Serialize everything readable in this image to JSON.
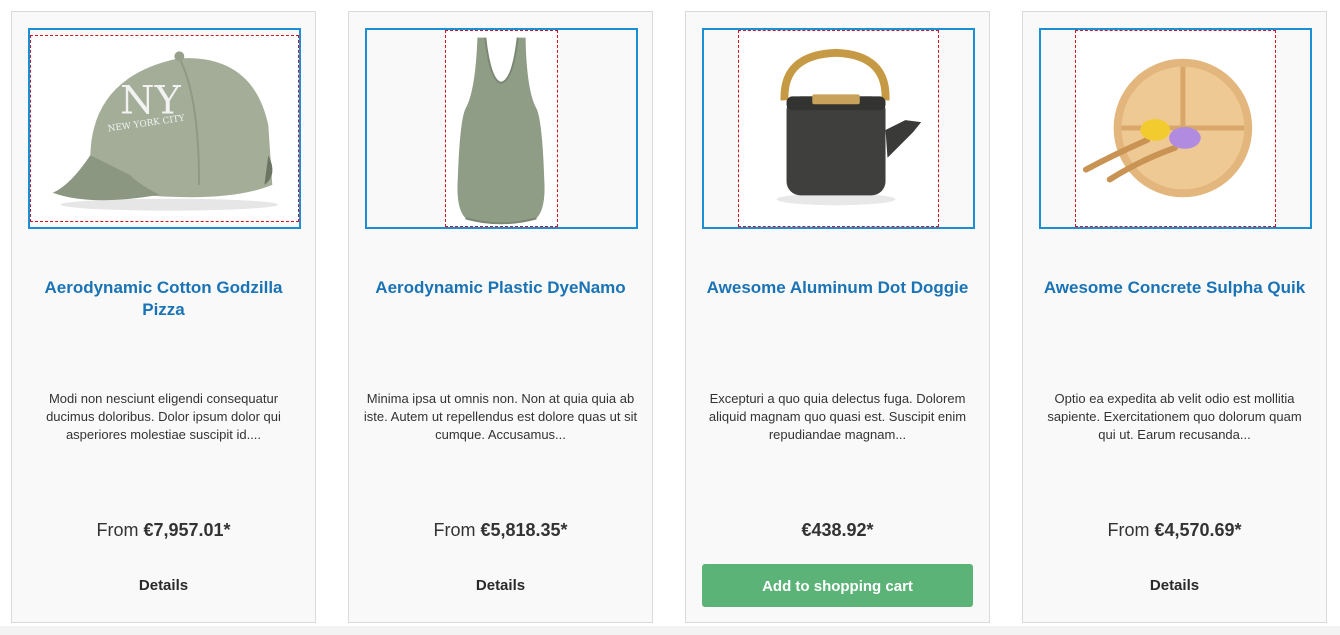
{
  "products": [
    {
      "title": "Aerodynamic Cotton Godzilla Pizza",
      "description": "Modi non nesciunt eligendi consequatur ducimus doloribus. Dolor ipsum dolor qui asperiores molestiae suscipit id....",
      "price_prefix": "From ",
      "price": "€7,957.01*",
      "action": "Details",
      "image": "cap-image",
      "cap_text": "NY",
      "cap_subtext": "NEW YORK CITY"
    },
    {
      "title": "Aerodynamic Plastic DyeNamo",
      "description": "Minima ipsa ut omnis non. Non at quia quia ab iste. Autem ut repellendus est dolore quas ut sit cumque. Accusamus...",
      "price_prefix": "From ",
      "price": "€5,818.35*",
      "action": "Details",
      "image": "tank-top-image"
    },
    {
      "title": "Awesome Aluminum Dot Doggie",
      "description": "Excepturi a quo quia delectus fuga. Dolorem aliquid magnam quo quasi est. Suscipit enim repudiandae magnam...",
      "price_prefix": "",
      "price": "€438.92*",
      "action": "Add to shopping cart",
      "image": "teapot-image"
    },
    {
      "title": "Awesome Concrete Sulpha Quik",
      "description": "Optio ea expedita ab velit odio est mollitia sapiente. Exercitationem quo dolorum quam qui ut. Earum recusanda...",
      "price_prefix": "From ",
      "price": "€4,570.69*",
      "action": "Details",
      "image": "bamboo-plate-image"
    }
  ],
  "colors": {
    "title": "#1a73b5",
    "image_frame": "#1b8fd3",
    "image_dashed": "#d0141e",
    "cart_button": "#5cb377"
  }
}
